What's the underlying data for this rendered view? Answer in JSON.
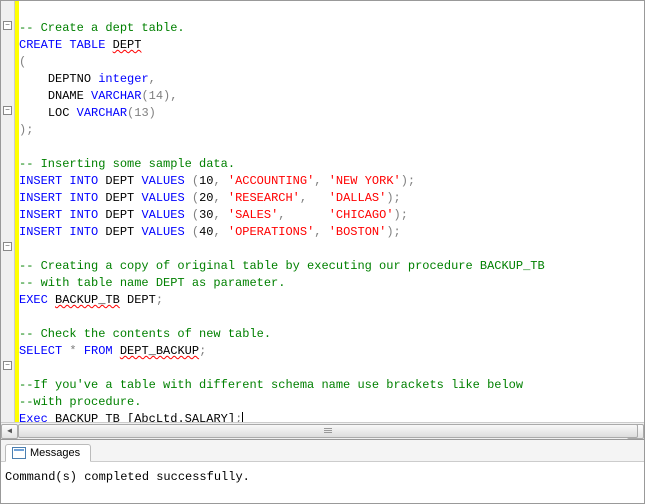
{
  "code": {
    "l1_comment": "-- Create a dept table.",
    "l2_kw": "CREATE TABLE",
    "l2_tbl": "DEPT",
    "l3": "(",
    "l4_col": "DEPTNO",
    "l4_type": "integer",
    "l4_c": ",",
    "l5_col": "DNAME",
    "l5_type": "VARCHAR",
    "l5_args": "(14)",
    "l5_c": ",",
    "l6_col": "LOC",
    "l6_type": "VARCHAR",
    "l6_args": "(13)",
    "l7": ");",
    "l9_comment": "-- Inserting some sample data.",
    "ins_kw": "INSERT INTO",
    "ins_tbl": "DEPT",
    "ins_vals": "VALUES",
    "r1_n": "10",
    "r1_s1": "'ACCOUNTING'",
    "r1_s2": "'NEW YORK'",
    "r2_n": "20",
    "r2_s1": "'RESEARCH'",
    "r2_s2": "'DALLAS'",
    "r3_n": "30",
    "r3_s1": "'SALES'",
    "r3_s2": "'CHICAGO'",
    "r4_n": "40",
    "r4_s1": "'OPERATIONS'",
    "r4_s2": "'BOSTON'",
    "l15_comment": "-- Creating a copy of original table by executing our procedure BACKUP_TB",
    "l16_comment": "-- with table name DEPT as parameter.",
    "l17_kw": "EXEC",
    "l17_proc": "BACKUP_TB",
    "l17_arg": "DEPT",
    "l17_c": ";",
    "l19_comment": "-- Check the contents of new table.",
    "l20_kw1": "SELECT",
    "l20_star": "*",
    "l20_kw2": "FROM",
    "l20_tbl": "DEPT_BACKUP",
    "l20_c": ";",
    "l22_comment": "--If you've a table with different schema name use brackets like below",
    "l23_comment": "--with procedure.",
    "l24_kw": "Exec",
    "l24_proc": "BACKUP_TB",
    "l24_arg": "[AbcLtd.SALARY]",
    "l24_c": ";"
  },
  "messages": {
    "tab_label": "Messages",
    "output": "Command(s) completed successfully."
  },
  "fold_glyph": "−"
}
